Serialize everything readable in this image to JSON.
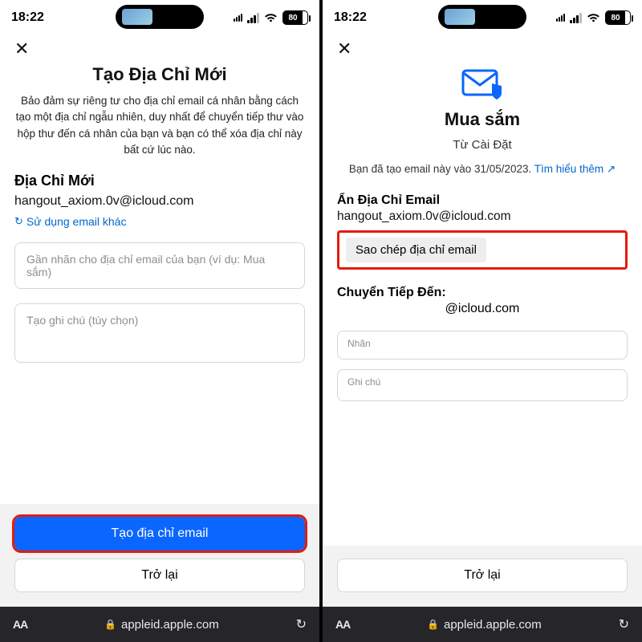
{
  "statusbar": {
    "time": "18:22",
    "battery": "80"
  },
  "left": {
    "title": "Tạo Địa Chỉ Mới",
    "desc": "Bảo đảm sự riêng tư cho địa chỉ email cá nhân bằng cách tạo một địa chỉ ngẫu nhiên, duy nhất để chuyển tiếp thư vào hộp thư đến cá nhân của bạn và bạn có thể xóa địa chỉ này bất cứ lúc nào.",
    "new_addr_label": "Địa Chỉ Mới",
    "new_addr_value": "hangout_axiom.0v@icloud.com",
    "use_other": "Sử dụng email khác",
    "label_ph": "Gần nhãn cho địa chỉ email của bạn (ví dụ: Mua sắm)",
    "note_ph": "Tạo ghi chú (tùy chọn)",
    "create_btn": "Tạo địa chỉ email",
    "back_btn": "Trở lại"
  },
  "right": {
    "title": "Mua sắm",
    "subtitle": "Từ Cài Đặt",
    "info_prefix": "Bạn đã tạo email này vào 31/05/2023. ",
    "learn_more": "Tìm hiểu thêm ↗",
    "hide_label": "Ẩn Địa Chỉ Email",
    "hide_value": "hangout_axiom.0v@icloud.com",
    "copy_btn": "Sao chép địa chỉ email",
    "fwd_label": "Chuyển Tiếp Đến:",
    "fwd_value": "@icloud.com",
    "nhLabel": "Nhãn",
    "noteLabel": "Ghi chú",
    "back_btn": "Trở lại"
  },
  "safari": {
    "url": "appleid.apple.com",
    "aa": "AA"
  }
}
